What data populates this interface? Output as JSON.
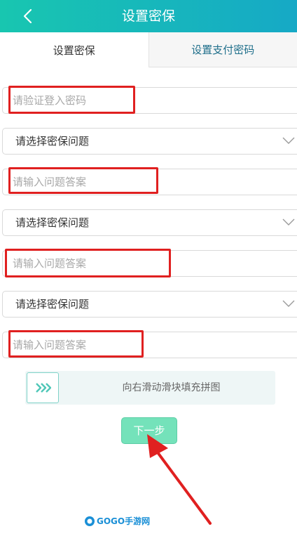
{
  "header": {
    "title": "设置密保"
  },
  "tabs": [
    {
      "label": "设置密保",
      "active": true
    },
    {
      "label": "设置支付密码",
      "active": false
    }
  ],
  "form": {
    "password_placeholder": "请验证登入密码",
    "question_1": "请选择密保问题",
    "answer_1_placeholder": "请输入问题答案",
    "question_2": "请选择密保问题",
    "answer_2_placeholder": "请输入问题答案",
    "question_3": "请选择密保问题",
    "answer_3_placeholder": "请输入问题答案"
  },
  "slider": {
    "text": "向右滑动滑块填充拼图"
  },
  "next_button": {
    "label": "下一步"
  },
  "watermark": {
    "text": "GOGO手游网"
  },
  "icons": {
    "back": "chevron-left-icon",
    "dropdown": "chevron-down-icon",
    "slider": "double-chevron-right-icon"
  },
  "colors": {
    "header_start": "#18c6b0",
    "header_end": "#16a9c6",
    "next_button": "#74e2ba",
    "highlight": "#e02020",
    "tab_inactive_text": "#1f6f8b"
  }
}
